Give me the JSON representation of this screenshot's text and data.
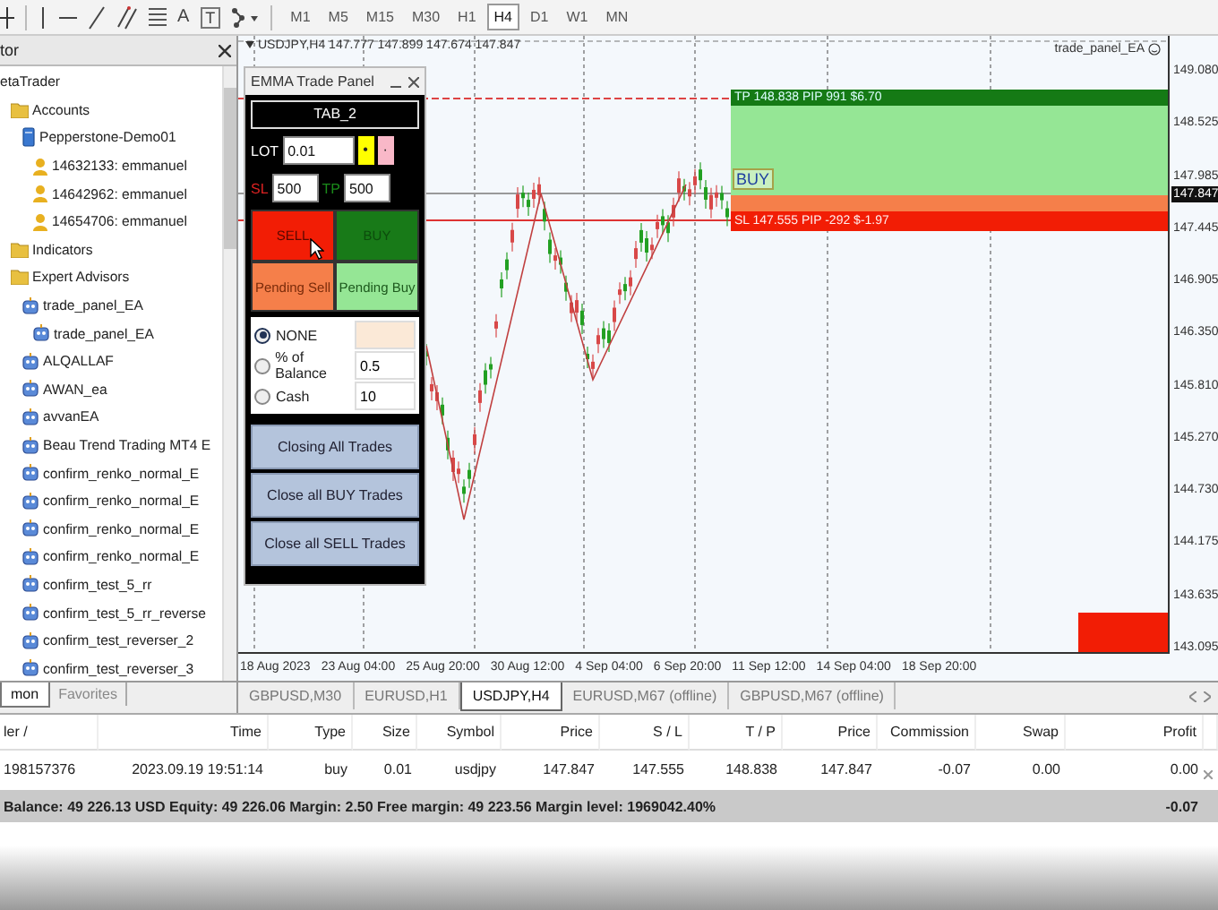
{
  "toolbar": {
    "text_tool": "A",
    "label_tool": "T",
    "timeframes": [
      {
        "label": "M1",
        "selected": false
      },
      {
        "label": "M5",
        "selected": false
      },
      {
        "label": "M15",
        "selected": false
      },
      {
        "label": "M30",
        "selected": false
      },
      {
        "label": "H1",
        "selected": false
      },
      {
        "label": "H4",
        "selected": true
      },
      {
        "label": "D1",
        "selected": false
      },
      {
        "label": "W1",
        "selected": false
      },
      {
        "label": "MN",
        "selected": false
      }
    ]
  },
  "navigator": {
    "title": "tor",
    "tree": [
      {
        "label": "etaTrader",
        "children": [
          {
            "label": "Accounts",
            "kind": "folder",
            "children": [
              {
                "label": "Pepperstone-Demo01",
                "kind": "server",
                "children": [
                  {
                    "label": "14632133: emmanuel",
                    "kind": "account"
                  },
                  {
                    "label": "14642962: emmanuel",
                    "kind": "account"
                  },
                  {
                    "label": "14654706: emmanuel",
                    "kind": "account"
                  }
                ]
              }
            ]
          },
          {
            "label": "Indicators",
            "kind": "folder"
          },
          {
            "label": "Expert Advisors",
            "kind": "folder",
            "children": [
              {
                "label": "trade_panel_EA",
                "kind": "expert",
                "children": [
                  {
                    "label": "trade_panel_EA",
                    "kind": "expert"
                  }
                ]
              },
              {
                "label": "ALQALLAF",
                "kind": "expert"
              },
              {
                "label": "AWAN_ea",
                "kind": "expert"
              },
              {
                "label": "avvanEA",
                "kind": "expert"
              },
              {
                "label": "Beau Trend Trading MT4 E",
                "kind": "expert"
              },
              {
                "label": "confirm_renko_normal_E",
                "kind": "expert"
              },
              {
                "label": "confirm_renko_normal_E",
                "kind": "expert"
              },
              {
                "label": "confirm_renko_normal_E",
                "kind": "expert"
              },
              {
                "label": "confirm_renko_normal_E",
                "kind": "expert"
              },
              {
                "label": "confirm_test_5_rr",
                "kind": "expert"
              },
              {
                "label": "confirm_test_5_rr_reverse",
                "kind": "expert"
              },
              {
                "label": "confirm_test_reverser_2",
                "kind": "expert"
              },
              {
                "label": "confirm_test_reverser_3",
                "kind": "expert"
              }
            ]
          }
        ]
      }
    ],
    "tabs": [
      {
        "label": "mon",
        "selected": true
      },
      {
        "label": "Favorites",
        "selected": false
      }
    ]
  },
  "chart": {
    "header": "USDJPY,H4 147.777 147.899 147.674 147.847",
    "ea_label": "trade_panel_EA",
    "tp_label": "TP 148.838 PIP 991 $6.70",
    "sl_label": "SL 147.555 PIP -292 $-1.97",
    "order_label": "BUY",
    "price_ticks": [
      "149.080",
      "148.525",
      "147.985",
      "147.445",
      "146.905",
      "146.350",
      "145.810",
      "145.270",
      "144.730",
      "144.175",
      "143.635",
      "143.095"
    ],
    "current_price": "147.847",
    "date_ticks": [
      "18 Aug 2023",
      "23 Aug 04:00",
      "25 Aug 20:00",
      "30 Aug 12:00",
      "4 Sep 04:00",
      "6 Sep 20:00",
      "11 Sep 12:00",
      "14 Sep 04:00",
      "18 Sep 20:00"
    ]
  },
  "trade_panel": {
    "title": "EMMA Trade Panel",
    "tab": "TAB_2",
    "lot_label": "LOT",
    "lot": "0.01",
    "lot_plus": "•",
    "lot_minus": "·",
    "sl_label": "SL",
    "sl": "500",
    "tp_label": "TP",
    "tp": "500",
    "buttons": [
      {
        "label": "SELL",
        "kind": "sell"
      },
      {
        "label": "BUY",
        "kind": "buy"
      },
      {
        "label": "Pending Sell",
        "kind": "pending-sell"
      },
      {
        "label": "Pending Buy",
        "kind": "pending-buy"
      }
    ],
    "risk_options": [
      {
        "label": "NONE",
        "selected": true
      },
      {
        "label": "% of Balance",
        "selected": false,
        "value": "0.5"
      },
      {
        "label": "Cash",
        "selected": false,
        "value": "10"
      }
    ],
    "close_buttons": [
      "Closing All Trades",
      "Close all BUY Trades",
      "Close all SELL Trades"
    ]
  },
  "chart_tabs": [
    {
      "label": "GBPUSD,M30",
      "selected": false
    },
    {
      "label": "EURUSD,H1",
      "selected": false
    },
    {
      "label": "USDJPY,H4",
      "selected": true
    },
    {
      "label": "EURUSD,M67 (offline)",
      "selected": false
    },
    {
      "label": "GBPUSD,M67 (offline)",
      "selected": false
    }
  ],
  "trades": {
    "columns": [
      "ler /",
      "Time",
      "Type",
      "Size",
      "Symbol",
      "Price",
      "S / L",
      "T / P",
      "Price",
      "Commission",
      "Swap",
      "Profit"
    ],
    "rows": [
      [
        "198157376",
        "2023.09.19 19:51:14",
        "buy",
        "0.01",
        "usdjpy",
        "147.847",
        "147.555",
        "148.838",
        "147.847",
        "-0.07",
        "0.00",
        "0.00"
      ]
    ],
    "summary": "Balance: 49 226.13 USD  Equity: 49 226.06  Margin: 2.50  Free margin: 49 223.56  Margin level: 1969042.40%",
    "summary_profit": "-0.07"
  }
}
